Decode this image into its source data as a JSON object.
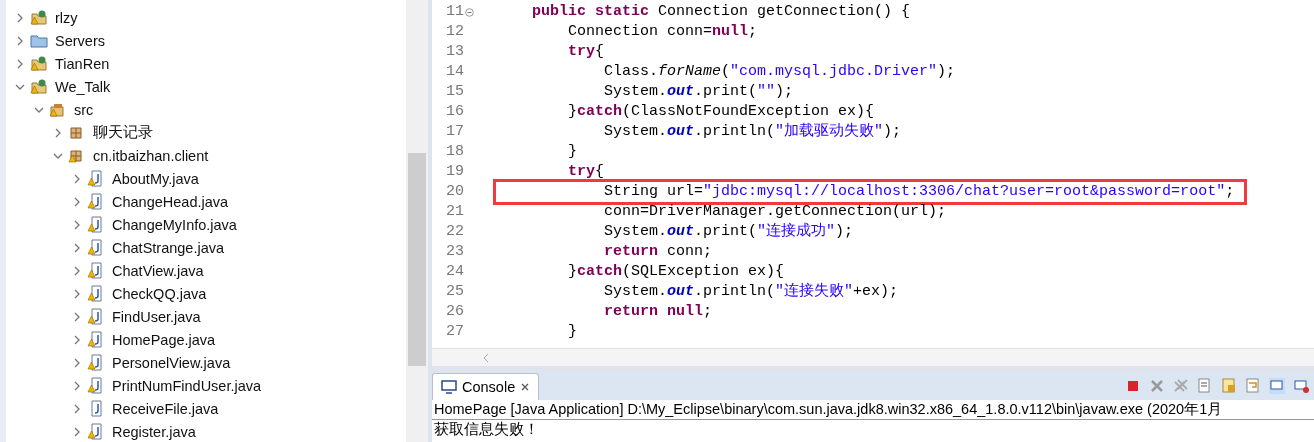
{
  "project_tree": [
    {
      "label": "rlzy",
      "kind": "project",
      "warning": true,
      "expanded": false
    },
    {
      "label": "Servers",
      "kind": "folder",
      "warning": false,
      "expanded": false
    },
    {
      "label": "TianRen",
      "kind": "project",
      "warning": true,
      "expanded": false
    },
    {
      "label": "We_Talk",
      "kind": "project",
      "warning": true,
      "expanded": true,
      "children": [
        {
          "label": "src",
          "kind": "source-folder",
          "warning": true,
          "expanded": true,
          "children": [
            {
              "label": "聊天记录",
              "kind": "package",
              "warning": false,
              "expanded": false
            },
            {
              "label": "cn.itbaizhan.client",
              "kind": "package",
              "warning": true,
              "expanded": true,
              "children": [
                {
                  "label": "AboutMy.java",
                  "kind": "java-file",
                  "warning": true,
                  "expanded": false
                },
                {
                  "label": "ChangeHead.java",
                  "kind": "java-file",
                  "warning": true,
                  "expanded": false
                },
                {
                  "label": "ChangeMyInfo.java",
                  "kind": "java-file",
                  "warning": true,
                  "expanded": false
                },
                {
                  "label": "ChatStrange.java",
                  "kind": "java-file",
                  "warning": true,
                  "expanded": false
                },
                {
                  "label": "ChatView.java",
                  "kind": "java-file",
                  "warning": true,
                  "expanded": false
                },
                {
                  "label": "CheckQQ.java",
                  "kind": "java-file",
                  "warning": true,
                  "expanded": false
                },
                {
                  "label": "FindUser.java",
                  "kind": "java-file",
                  "warning": true,
                  "expanded": false
                },
                {
                  "label": "HomePage.java",
                  "kind": "java-file",
                  "warning": true,
                  "expanded": false
                },
                {
                  "label": "PersonelView.java",
                  "kind": "java-file",
                  "warning": true,
                  "expanded": false
                },
                {
                  "label": "PrintNumFindUser.java",
                  "kind": "java-file",
                  "warning": true,
                  "expanded": false
                },
                {
                  "label": "ReceiveFile.java",
                  "kind": "java-file",
                  "warning": false,
                  "expanded": false
                },
                {
                  "label": "Register.java",
                  "kind": "java-file",
                  "warning": true,
                  "expanded": false
                }
              ]
            }
          ]
        }
      ]
    }
  ],
  "editor": {
    "lines": [
      {
        "number": "11",
        "folded": false,
        "tokens": [
          {
            "text": "    public static",
            "kind": "keyword"
          },
          {
            "text": " Connection getConnection() {",
            "kind": "plain"
          }
        ]
      },
      {
        "number": "12",
        "tokens": [
          {
            "text": "        Connection conn=",
            "kind": "plain"
          },
          {
            "text": "null",
            "kind": "keyword"
          },
          {
            "text": ";",
            "kind": "plain"
          }
        ]
      },
      {
        "number": "13",
        "tokens": [
          {
            "text": "        try",
            "kind": "keyword"
          },
          {
            "text": "{",
            "kind": "plain"
          }
        ]
      },
      {
        "number": "14",
        "tokens": [
          {
            "text": "            Class.",
            "kind": "plain"
          },
          {
            "text": "forName",
            "kind": "static-method"
          },
          {
            "text": "(",
            "kind": "plain"
          },
          {
            "text": "\"com.mysql.jdbc.Driver\"",
            "kind": "string"
          },
          {
            "text": ");",
            "kind": "plain"
          }
        ]
      },
      {
        "number": "15",
        "tokens": [
          {
            "text": "            System.",
            "kind": "plain"
          },
          {
            "text": "out",
            "kind": "static-field"
          },
          {
            "text": ".print(",
            "kind": "plain"
          },
          {
            "text": "\"\"",
            "kind": "string"
          },
          {
            "text": ");",
            "kind": "plain"
          }
        ]
      },
      {
        "number": "16",
        "tokens": [
          {
            "text": "        }",
            "kind": "plain"
          },
          {
            "text": "catch",
            "kind": "keyword"
          },
          {
            "text": "(ClassNotFoundException ex){",
            "kind": "plain"
          }
        ]
      },
      {
        "number": "17",
        "tokens": [
          {
            "text": "            System.",
            "kind": "plain"
          },
          {
            "text": "out",
            "kind": "static-field"
          },
          {
            "text": ".println(",
            "kind": "plain"
          },
          {
            "text": "\"加载驱动失败\"",
            "kind": "string"
          },
          {
            "text": ");",
            "kind": "plain"
          }
        ]
      },
      {
        "number": "18",
        "tokens": [
          {
            "text": "        }",
            "kind": "plain"
          }
        ]
      },
      {
        "number": "19",
        "tokens": [
          {
            "text": "        try",
            "kind": "keyword"
          },
          {
            "text": "{",
            "kind": "plain"
          }
        ]
      },
      {
        "number": "20",
        "highlighted": true,
        "tokens": [
          {
            "text": "            String url=",
            "kind": "plain"
          },
          {
            "text": "\"jdbc:mysql://localhost:3306/chat?user=root&password=root\"",
            "kind": "string"
          },
          {
            "text": ";",
            "kind": "plain"
          }
        ]
      },
      {
        "number": "21",
        "tokens": [
          {
            "text": "            conn=DriverManager.getConnection(url);",
            "kind": "plain"
          }
        ]
      },
      {
        "number": "22",
        "tokens": [
          {
            "text": "            System.",
            "kind": "plain"
          },
          {
            "text": "out",
            "kind": "static-field"
          },
          {
            "text": ".print(",
            "kind": "plain"
          },
          {
            "text": "\"连接成功\"",
            "kind": "string"
          },
          {
            "text": ");",
            "kind": "plain"
          }
        ]
      },
      {
        "number": "23",
        "tokens": [
          {
            "text": "            return",
            "kind": "keyword"
          },
          {
            "text": " conn;",
            "kind": "plain"
          }
        ]
      },
      {
        "number": "24",
        "tokens": [
          {
            "text": "        }",
            "kind": "plain"
          },
          {
            "text": "catch",
            "kind": "keyword"
          },
          {
            "text": "(SQLException ex){",
            "kind": "plain"
          }
        ]
      },
      {
        "number": "25",
        "tokens": [
          {
            "text": "            System.",
            "kind": "plain"
          },
          {
            "text": "out",
            "kind": "static-field"
          },
          {
            "text": ".println(",
            "kind": "plain"
          },
          {
            "text": "\"连接失败\"",
            "kind": "string"
          },
          {
            "text": "+ex);",
            "kind": "plain"
          }
        ]
      },
      {
        "number": "26",
        "tokens": [
          {
            "text": "            return null",
            "kind": "keyword"
          },
          {
            "text": ";",
            "kind": "plain"
          }
        ]
      },
      {
        "number": "27",
        "tokens": [
          {
            "text": "        }",
            "kind": "plain"
          }
        ]
      }
    ]
  },
  "console": {
    "tab": {
      "label": "Console",
      "selected": true
    },
    "launch_line": "HomePage [Java Application] D:\\My_Eclipse\\binary\\com.sun.java.jdk8.win32.x86_64_1.8.0.v112\\bin\\javaw.exe (2020年1月",
    "output": [
      "获取信息失败！"
    ]
  }
}
